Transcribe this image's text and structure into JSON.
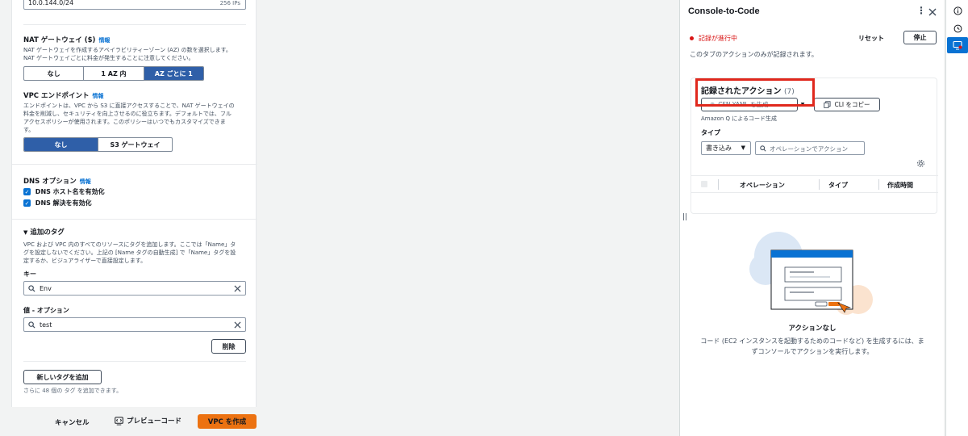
{
  "subnet": {
    "cidr": "10.0.144.0/24",
    "ips": "256 IPs"
  },
  "nat": {
    "label": "NAT ゲートウェイ ($)",
    "info": "情報",
    "desc1": "NAT ゲートウェイを作成するアベイラビリティーゾーン (AZ) の数を選択します。",
    "desc2": "NAT ゲートウェイごとに料金が発生することに注意してください。",
    "options": [
      "なし",
      "1 AZ 内",
      "AZ ごとに 1"
    ]
  },
  "vpce": {
    "label": "VPC エンドポイント",
    "info": "情報",
    "desc1": "エンドポイントは、VPC から S3 に直接アクセスすることで、NAT ゲートウェイの",
    "desc2": "料金を削減し、セキュリティを向上させるのに役立ちます。デフォルトでは、フル",
    "desc3": "アクセスポリシーが使用されます。このポリシーはいつでもカスタマイズできま",
    "desc4": "す。",
    "options": [
      "なし",
      "S3 ゲートウェイ"
    ]
  },
  "dns": {
    "label": "DNS オプション",
    "info": "情報",
    "hostnames": "DNS ホスト名を有効化",
    "resolution": "DNS 解決を有効化"
  },
  "tags": {
    "label": "追加のタグ",
    "desc1": "VPC および VPC 内のすべてのリソースにタグを追加します。ここでは「Name」タ",
    "desc2": "グを設定しないでください。上記の [Name タグの自動生成] で「Name」タグを設",
    "desc3": "定するか、ビジュアライザーで直接設定します。",
    "key_label": "キー",
    "key_value": "Env",
    "value_label": "値 - オプション",
    "value_value": "test",
    "remove": "削除",
    "add": "新しいタグを追加",
    "remaining": "さらに 48 個の タグ を追加できます。"
  },
  "footer": {
    "cancel": "キャンセル",
    "preview": "プレビューコード",
    "create": "VPC を作成"
  },
  "panel": {
    "title": "Console-to-Code",
    "recording": "記録が進行中",
    "reset": "リセット",
    "stop": "停止",
    "scope": "このタブのアクションのみが記録されます。",
    "actions_title": "記録されたアクション",
    "actions_count": "(7)",
    "gen_yaml": "CFN YAML を生成",
    "copy_cli": "CLI をコピー",
    "amazon_q": "Amazon Q によるコード生成",
    "type_label": "タイプ",
    "type_value": "書き込み",
    "search_placeholder": "オペレーションでアクション",
    "col_operation": "オペレーション",
    "col_type": "タイプ",
    "col_time": "作成時間",
    "empty_title": "アクションなし",
    "empty_desc1": "コード (EC2 インスタンスを起動するためのコードなど) を生成するには、ま",
    "empty_desc2": "ずコンソールでアクションを実行します。"
  },
  "colors": {
    "accent": "#0972d3",
    "primary": "#ec7211",
    "danger": "#d91515",
    "highlight": "#e0281d"
  }
}
